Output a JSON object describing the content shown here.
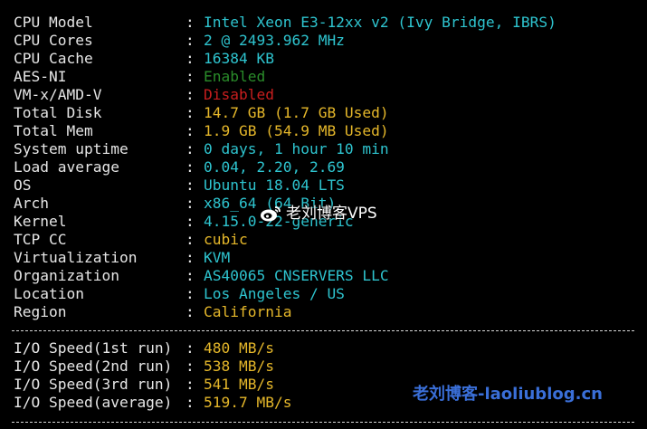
{
  "rows": [
    {
      "label": "CPU Model",
      "colon": ":",
      "value": "Intel Xeon E3-12xx v2 (Ivy Bridge, IBRS)",
      "color": "cyan"
    },
    {
      "label": "CPU Cores",
      "colon": ":",
      "value": "2 @ 2493.962 MHz",
      "color": "cyan"
    },
    {
      "label": "CPU Cache",
      "colon": ":",
      "value": "16384 KB",
      "color": "cyan"
    },
    {
      "label": "AES-NI",
      "colon": ":",
      "value": "Enabled",
      "color": "green"
    },
    {
      "label": "VM-x/AMD-V",
      "colon": ":",
      "value": "Disabled",
      "color": "red"
    },
    {
      "label": "Total Disk",
      "colon": ":",
      "value": "14.7 GB (1.7 GB Used)",
      "color": "yellow"
    },
    {
      "label": "Total Mem",
      "colon": ":",
      "value": "1.9 GB (54.9 MB Used)",
      "color": "yellow"
    },
    {
      "label": "System uptime",
      "colon": ":",
      "value": "0 days, 1 hour 10 min",
      "color": "cyan"
    },
    {
      "label": "Load average",
      "colon": ":",
      "value": "0.04, 2.20, 2.69",
      "color": "cyan"
    },
    {
      "label": "OS",
      "colon": ":",
      "value": "Ubuntu 18.04 LTS",
      "color": "cyan"
    },
    {
      "label": "Arch",
      "colon": ":",
      "value": "x86_64 (64 Bit)",
      "color": "cyan"
    },
    {
      "label": "Kernel",
      "colon": ":",
      "value": "4.15.0-22-generic",
      "color": "cyan"
    },
    {
      "label": "TCP CC",
      "colon": ":",
      "value": "cubic",
      "color": "yellow"
    },
    {
      "label": "Virtualization",
      "colon": ":",
      "value": "KVM",
      "color": "cyan"
    },
    {
      "label": "Organization",
      "colon": ":",
      "value": "AS40065 CNSERVERS LLC",
      "color": "cyan"
    },
    {
      "label": "Location",
      "colon": ":",
      "value": "Los Angeles / US",
      "color": "cyan"
    },
    {
      "label": "Region",
      "colon": ":",
      "value": "California",
      "color": "yellow"
    }
  ],
  "io_rows": [
    {
      "label": "I/O Speed(1st run)",
      "colon": ":",
      "value": "480 MB/s",
      "color": "yellow"
    },
    {
      "label": "I/O Speed(2nd run)",
      "colon": ":",
      "value": "538 MB/s",
      "color": "yellow"
    },
    {
      "label": "I/O Speed(3rd run)",
      "colon": ":",
      "value": "541 MB/s",
      "color": "yellow"
    },
    {
      "label": "I/O Speed(average)",
      "colon": ":",
      "value": "519.7 MB/s",
      "color": "yellow"
    }
  ],
  "colors": {
    "background": "#000000",
    "label": "#e6e6e6",
    "cyan": "#2ec4cf",
    "yellow": "#e5b72a",
    "green": "#2a8c2a",
    "red": "#c81e1e"
  },
  "watermarks": {
    "center_text": "老刘博客VPS",
    "center_icon": "weibo-icon",
    "corner_text": "老刘博客-laoliublog.cn"
  }
}
